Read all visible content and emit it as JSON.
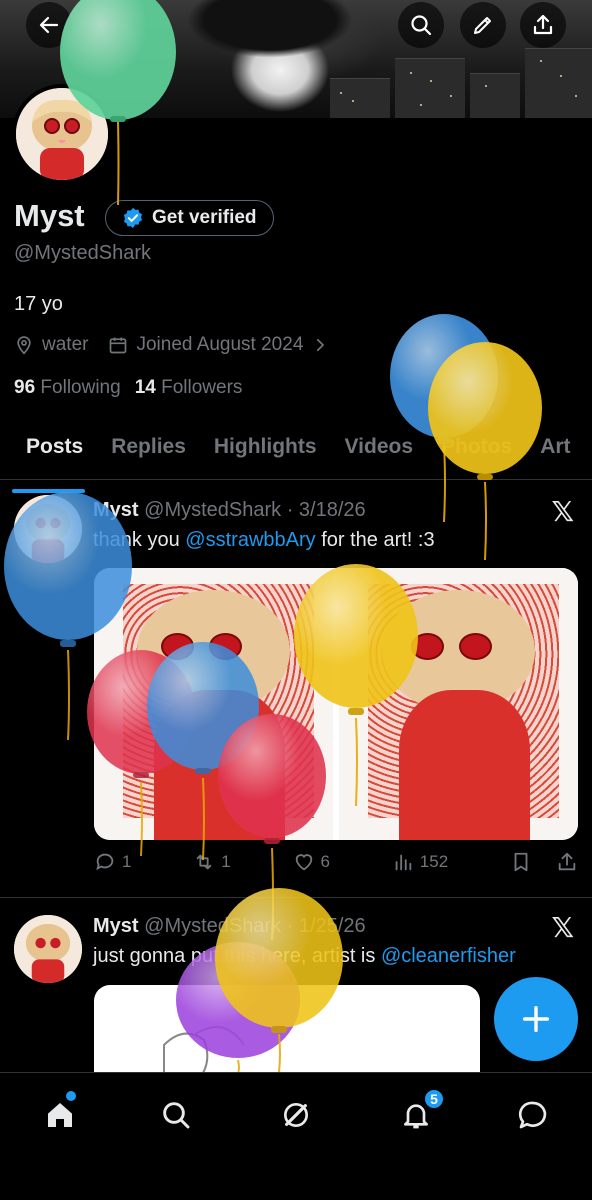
{
  "header": {
    "back_icon": "arrow-left-icon",
    "search_icon": "search-icon",
    "edit_icon": "pencil-icon",
    "share_icon": "share-icon"
  },
  "profile": {
    "name": "Myst",
    "verify_label": "Get verified",
    "handle": "@MystedShark",
    "bio": "17 yo",
    "location": "water",
    "joined": "Joined August 2024",
    "following_count": "96",
    "following_label": "Following",
    "followers_count": "14",
    "followers_label": "Followers"
  },
  "tabs": [
    {
      "label": "Posts",
      "active": true
    },
    {
      "label": "Replies"
    },
    {
      "label": "Highlights"
    },
    {
      "label": "Videos"
    },
    {
      "label": "Photos"
    },
    {
      "label": "Art"
    }
  ],
  "posts": [
    {
      "name": "Myst",
      "handle": "@MystedShark",
      "date": "· 3/18/26",
      "text_before": "thank you ",
      "mention": "@sstrawbbAry",
      "text_after": " for the art! :3",
      "replies": "1",
      "reposts": "1",
      "likes": "6",
      "views": "152"
    },
    {
      "name": "Myst",
      "handle": "@MystedShark",
      "date": "· 1/25/26",
      "text_before": "just gonna put this here, artist is ",
      "mention": "@cleanerfisher"
    }
  ],
  "nav": {
    "notifications_badge": "5"
  },
  "colors": {
    "accent": "#1d9bf0",
    "background": "#000000",
    "muted": "#71767b",
    "balloon_green": "#5fd39a",
    "balloon_blue": "#3d8fdc",
    "balloon_yellow": "#f0c419",
    "balloon_red": "#e0334f",
    "balloon_purple": "#9b3fdc"
  }
}
